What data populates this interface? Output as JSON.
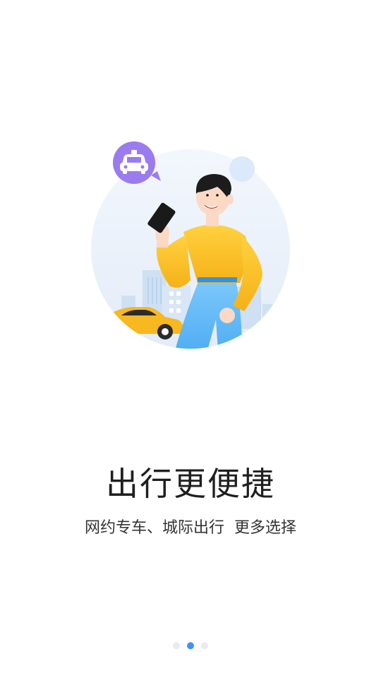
{
  "onboarding": {
    "title": "出行更便捷",
    "subtitle": "网约专车、城际出行  更多选择",
    "illustration_icon": "taxi-icon",
    "pager": {
      "total": 3,
      "active_index": 1
    }
  },
  "colors": {
    "accent": "#3d93f5",
    "dot_inactive": "#e9ebef",
    "taxi_badge": "#9b7bf0",
    "shirt": "#f5b922",
    "pants": "#5ab6f5",
    "car": "#f8b820"
  }
}
